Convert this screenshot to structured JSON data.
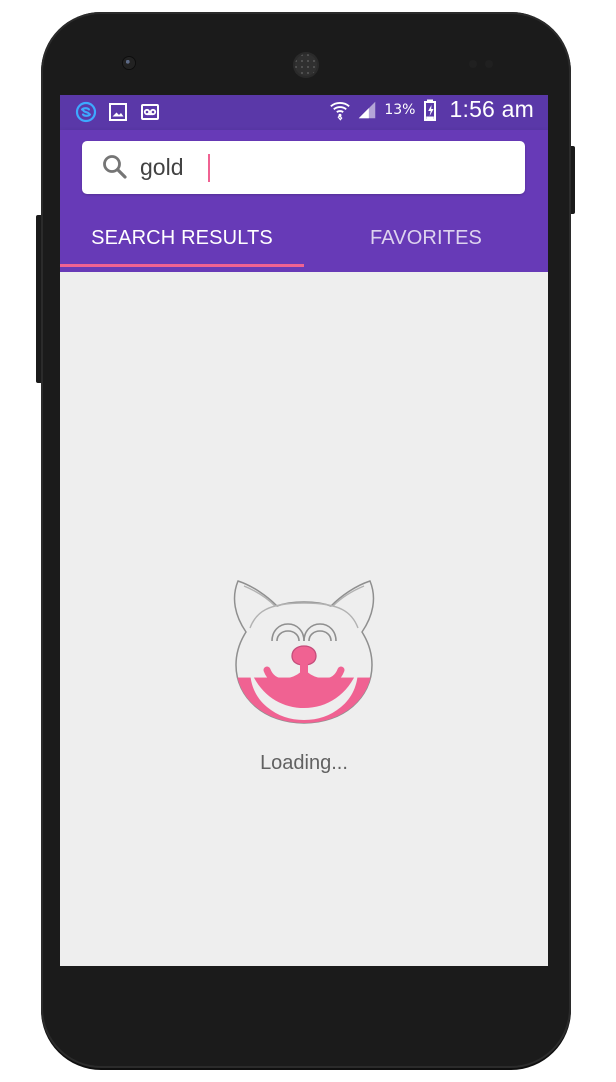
{
  "status_bar": {
    "icons_left": [
      "sync-app-icon",
      "gallery-icon",
      "voicemail-icon"
    ],
    "icons_right": [
      "wifi-icon",
      "signal-icon",
      "battery-icon"
    ],
    "battery_percent": "13%",
    "time": "1:56 am"
  },
  "search": {
    "value": "gold",
    "placeholder": "",
    "icon": "search-icon"
  },
  "tabs": [
    {
      "label": "SEARCH RESULTS",
      "selected": true
    },
    {
      "label": "FAVORITES",
      "selected": false
    }
  ],
  "loader": {
    "text": "Loading...",
    "progress_fraction": 0.32,
    "icon": "cat-face-icon",
    "fill_color": "#f06292",
    "outline_color": "#8f8f8f"
  },
  "colors": {
    "status_bar": "#5a38a8",
    "app_bar": "#673ab7",
    "accent": "#f06292",
    "background": "#eeeeee"
  }
}
